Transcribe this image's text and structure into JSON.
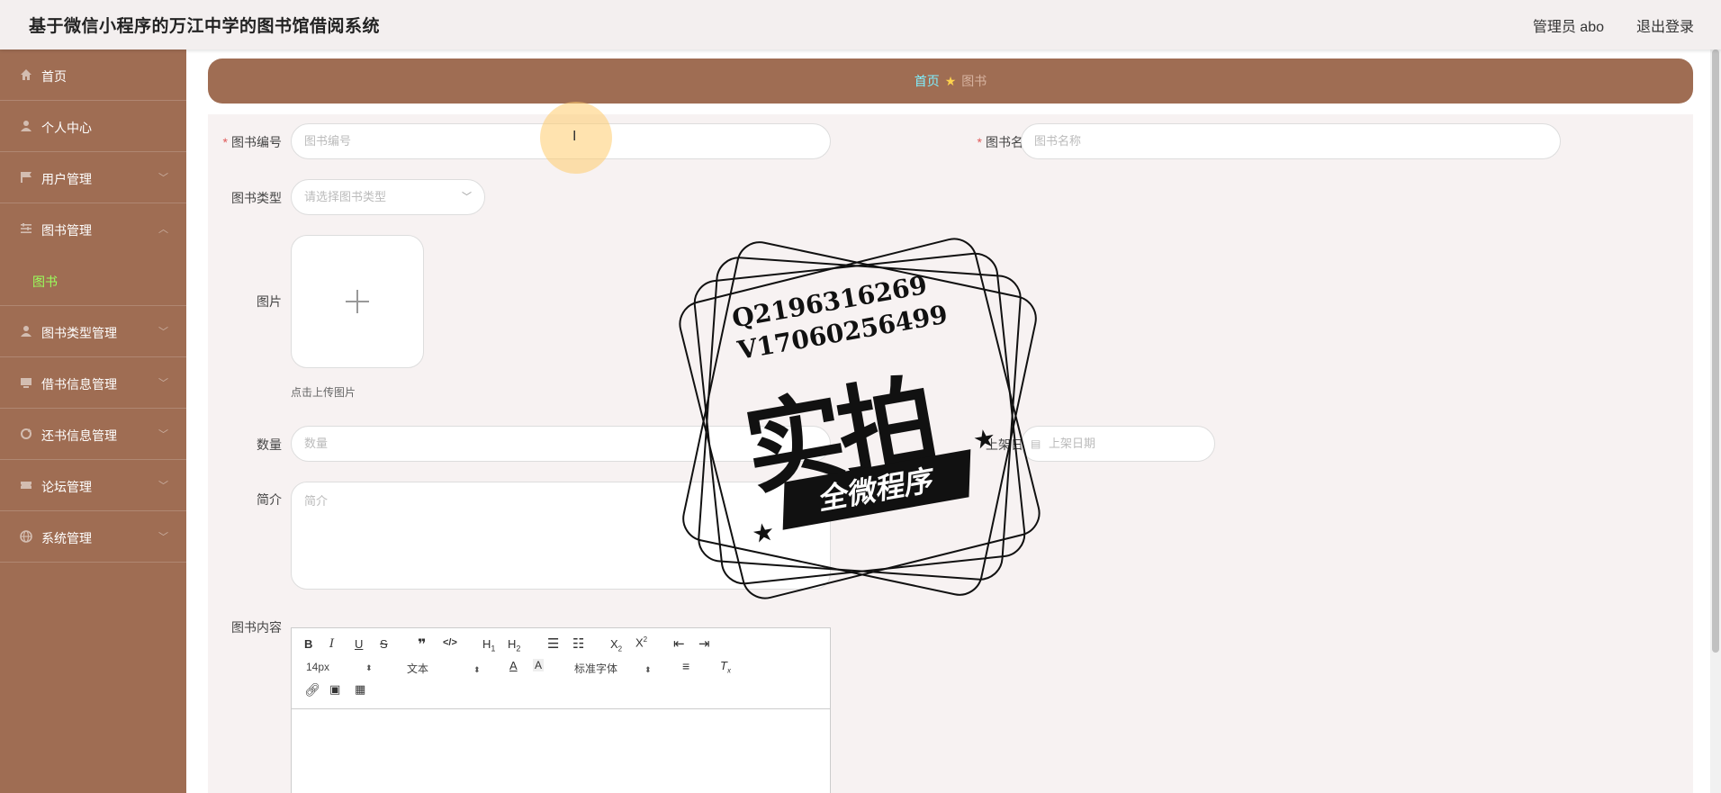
{
  "header": {
    "title": "基于微信小程序的万江中学的图书馆借阅系统",
    "user": "管理员 abo",
    "logout": "退出登录"
  },
  "sidebar": {
    "items": [
      {
        "label": "首页",
        "icon": "home-icon"
      },
      {
        "label": "个人中心",
        "icon": "user-icon"
      },
      {
        "label": "用户管理",
        "icon": "flag-icon"
      },
      {
        "label": "图书管理",
        "icon": "sliders-icon"
      },
      {
        "label": "图书类型管理",
        "icon": "user-icon"
      },
      {
        "label": "借书信息管理",
        "icon": "monitor-icon"
      },
      {
        "label": "还书信息管理",
        "icon": "recycle-icon"
      },
      {
        "label": "论坛管理",
        "icon": "ticket-icon"
      },
      {
        "label": "系统管理",
        "icon": "globe-icon"
      }
    ],
    "active_sub": "图书"
  },
  "breadcrumb": {
    "home": "首页",
    "current": "图书"
  },
  "form": {
    "book_no": {
      "label": "图书编号",
      "placeholder": "图书编号"
    },
    "book_name": {
      "label": "图书名称",
      "placeholder": "图书名称"
    },
    "book_type": {
      "label": "图书类型",
      "placeholder": "请选择图书类型"
    },
    "image": {
      "label": "图片",
      "hint": "点击上传图片"
    },
    "quantity": {
      "label": "数量",
      "placeholder": "数量"
    },
    "shelf_date": {
      "label": "上架日期",
      "placeholder": "上架日期"
    },
    "intro": {
      "label": "简介",
      "placeholder": "简介"
    },
    "content": {
      "label": "图书内容"
    }
  },
  "editor": {
    "font_size": "14px",
    "block_type": "文本",
    "font_family": "标准字体"
  },
  "stamp": {
    "line1": "Q2196316269",
    "line2": "V17060256499",
    "big": "实拍",
    "ribbon": "全微程序"
  }
}
